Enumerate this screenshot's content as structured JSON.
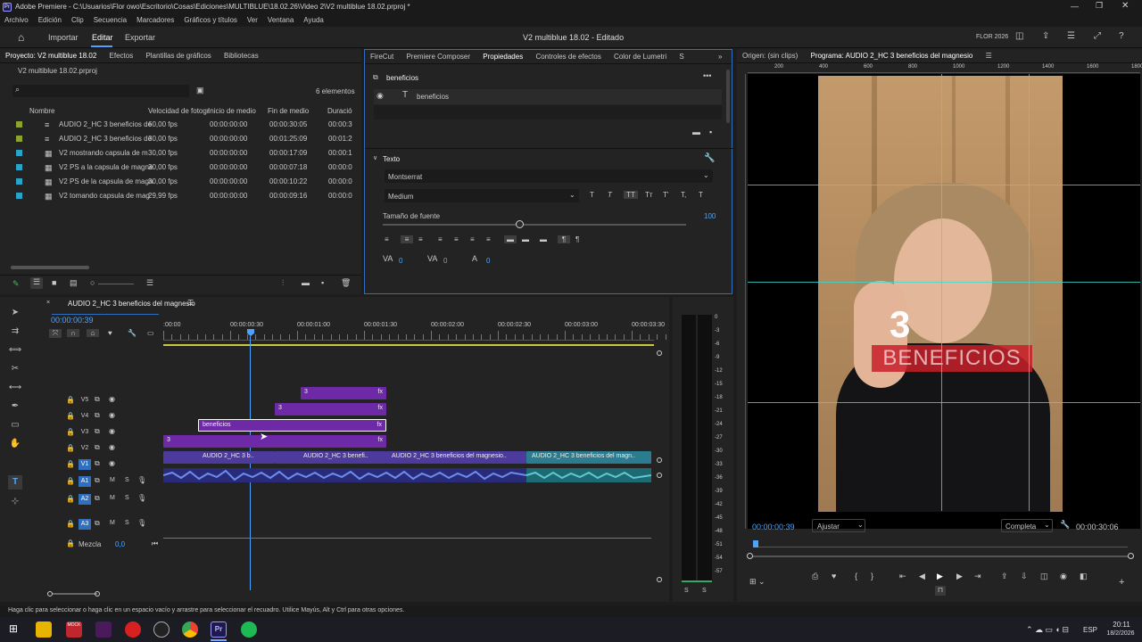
{
  "window": {
    "title": "Adobe Premiere - C:\\Usuarios\\Flor owo\\Escritorio\\Cosas\\Ediciones\\MULTIBLUE\\18.02.26\\Video 2\\V2 multiblue 18.02.prproj *",
    "app_icon": "Pr"
  },
  "menu": [
    "Archivo",
    "Edición",
    "Clip",
    "Secuencia",
    "Marcadores",
    "Gráficos y títulos",
    "Ver",
    "Ventana",
    "Ayuda"
  ],
  "appbar": {
    "tabs": [
      "Importar",
      "Editar",
      "Exportar"
    ],
    "center": "V2 multiblue 18.02  -  Editado",
    "workspace": "FLOR 2026"
  },
  "project": {
    "tabs": [
      "Proyecto: V2 multiblue 18.02",
      "Efectos",
      "Plantillas de gráficos",
      "Bibliotecas"
    ],
    "file": "V2 multiblue 18.02.prproj",
    "count": "6 elementos",
    "columns": [
      "Nombre",
      "Velocidad de fotogr",
      "Inicio de medio",
      "Fin de medio",
      "Duració"
    ],
    "rows": [
      {
        "name": "AUDIO 2_HC 3 beneficios de",
        "fps": "60,00 fps",
        "start": "00:00:00:00",
        "end": "00:00:30:05",
        "dur": "00:00:3",
        "color": "#8da32f"
      },
      {
        "name": "AUDIO 2_HC 3 beneficios de",
        "fps": "30,00 fps",
        "start": "00:00:00:00",
        "end": "00:01:25:09",
        "dur": "00:01:2",
        "color": "#8da32f"
      },
      {
        "name": "V2 mostrando capsula de m",
        "fps": "30,00 fps",
        "start": "00:00:00:00",
        "end": "00:00:17:09",
        "dur": "00:00:1",
        "color": "#2aa3c6"
      },
      {
        "name": "V2 PS a la capsula de magne",
        "fps": "30,00 fps",
        "start": "00:00:00:00",
        "end": "00:00:07:18",
        "dur": "00:00:0",
        "color": "#2aa3c6"
      },
      {
        "name": "V2 PS de la capsula de magn",
        "fps": "30,00 fps",
        "start": "00:00:00:00",
        "end": "00:00:10:22",
        "dur": "00:00:0",
        "color": "#2aa3c6"
      },
      {
        "name": "V2 tomando capsula de mag",
        "fps": "29,99 fps",
        "start": "00:00:00:00",
        "end": "00:00:09:16",
        "dur": "00:00:0",
        "color": "#2aa3c6"
      }
    ]
  },
  "props": {
    "tabs": [
      "FireCut",
      "Premiere Composer",
      "Propiedades",
      "Controles de efectos",
      "Color de Lumetri",
      "S"
    ],
    "layer_title": "beneficios",
    "layer_item": "beneficios",
    "section": "Texto",
    "font": "Montserrat",
    "style": "Medium",
    "size_label": "Tamaño de fuente",
    "size_value": "100",
    "size_level": 0.45,
    "kern": "0",
    "track": "0",
    "lead": "0"
  },
  "program": {
    "source_tab": "Origen: (sin clips)",
    "program_tab": "Programa: AUDIO 2_HC 3 beneficios del magnesio",
    "ruler": [
      "200",
      "400",
      "600",
      "800",
      "1000",
      "1200",
      "1400",
      "1600",
      "1800"
    ],
    "overlay_number": "3",
    "overlay_word": "BENEFICIOS",
    "timecode": "00:00:00:39",
    "fit": "Ajustar",
    "quality": "Completa",
    "duration": "00:00:30:06"
  },
  "timeline": {
    "seq_name": "AUDIO 2_HC 3 beneficios del magnesio",
    "timecode": "00:00:00:39",
    "ruler": [
      ":00:00",
      "00:00:00:30",
      "00:00:01:00",
      "00:00:01:30",
      "00:00:02:00",
      "00:00:02:30",
      "00:00:03:00",
      "00:00:03:30"
    ],
    "tracks": [
      "V5",
      "V4",
      "V3",
      "V2",
      "V1",
      "A1",
      "A2",
      "A3"
    ],
    "mix_label": "Mezcla",
    "mix_value": "0,0",
    "clips": {
      "v5": "3",
      "v4": "3",
      "v3": "beneficios",
      "v2": "3",
      "v1a": "AUDIO 2_HC 3 b..",
      "v1b": "AUDIO 2_HC 3 benefi..",
      "v1c": "AUDIO 2_HC 3 beneficios del magnesio..",
      "v1d": "AUDIO 2_HC 3 beneficios del magn.."
    }
  },
  "meter_ticks": [
    "0",
    "-3",
    "-6",
    "-9",
    "-12",
    "-15",
    "-18",
    "-21",
    "-24",
    "-27",
    "-30",
    "-33",
    "-36",
    "-39",
    "-42",
    "-45",
    "-48",
    "-51",
    "-54",
    "-57"
  ],
  "meter_footer": [
    "S",
    "S"
  ],
  "status": "Haga clic para seleccionar o haga clic en un espacio vacío y arrastre para seleccionar el recuadro. Utilice Mayús, Alt y Ctrl para otras opciones.",
  "taskbar": {
    "lang": "ESP",
    "time": "20:11",
    "date": "18/2/2026"
  }
}
